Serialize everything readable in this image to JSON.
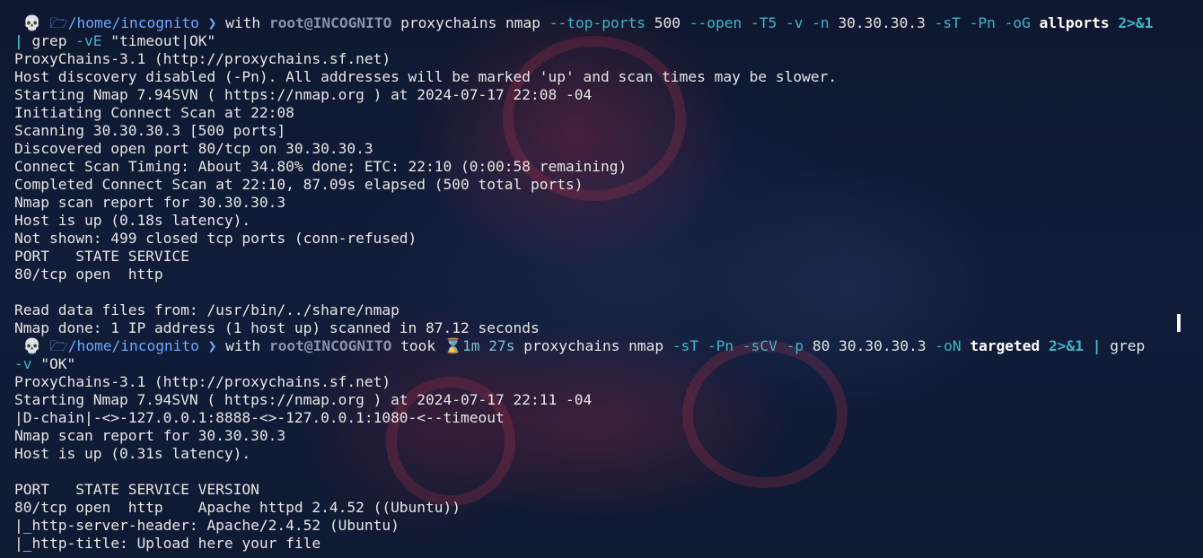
{
  "prompt1": {
    "icon": "skull-icon",
    "path": "/home/incognito",
    "with": "with",
    "user": "root@INCOGNITO",
    "cmd": "proxychains nmap",
    "flag1": "--top-ports",
    "val1": "500",
    "flag2": "--open -T5 -v -n",
    "ip": "30.30.30.3",
    "flag3": "-sT -Pn -oG",
    "file": "allports",
    "redir": "2>&1",
    "pipe": "|",
    "grep": "grep",
    "grep_flag": "-vE",
    "grep_str": "\"timeout|OK\""
  },
  "output1": [
    "ProxyChains-3.1 (http://proxychains.sf.net)",
    "Host discovery disabled (-Pn). All addresses will be marked 'up' and scan times may be slower.",
    "Starting Nmap 7.94SVN ( https://nmap.org ) at 2024-07-17 22:08 -04",
    "Initiating Connect Scan at 22:08",
    "Scanning 30.30.30.3 [500 ports]",
    "Discovered open port 80/tcp on 30.30.30.3",
    "Connect Scan Timing: About 34.80% done; ETC: 22:10 (0:00:58 remaining)",
    "Completed Connect Scan at 22:10, 87.09s elapsed (500 total ports)",
    "Nmap scan report for 30.30.30.3",
    "Host is up (0.18s latency).",
    "Not shown: 499 closed tcp ports (conn-refused)",
    "PORT   STATE SERVICE",
    "80/tcp open  http",
    "",
    "Read data files from: /usr/bin/../share/nmap",
    "Nmap done: 1 IP address (1 host up) scanned in 87.12 seconds"
  ],
  "prompt2": {
    "icon": "skull-icon",
    "path": "/home/incognito",
    "with": "with",
    "user": "root@INCOGNITO",
    "took": "took",
    "hourglass_icon": "hourglass-icon",
    "duration": "1m 27s",
    "cmd": "proxychains nmap",
    "flags": "-sT -Pn -sCV -p",
    "port": "80",
    "ip": "30.30.30.3",
    "flag_out": "-oN",
    "file": "targeted",
    "redir": "2>&1",
    "pipe": "|",
    "grep": "grep",
    "grep_flag": "-v",
    "grep_str": "\"OK\""
  },
  "output2": [
    "ProxyChains-3.1 (http://proxychains.sf.net)",
    "Starting Nmap 7.94SVN ( https://nmap.org ) at 2024-07-17 22:11 -04",
    "|D-chain|-<>-127.0.0.1:8888-<>-127.0.0.1:1080-<--timeout",
    "Nmap scan report for 30.30.30.3",
    "Host is up (0.31s latency).",
    "",
    "PORT   STATE SERVICE VERSION",
    "80/tcp open  http    Apache httpd 2.4.52 ((Ubuntu))",
    "|_http-server-header: Apache/2.4.52 (Ubuntu)",
    "|_http-title: Upload here your file"
  ],
  "colors": {
    "background": "#0f1a33",
    "path": "#6ea8ff",
    "flag": "#3fb6c6",
    "text": "#e6e6e6"
  }
}
